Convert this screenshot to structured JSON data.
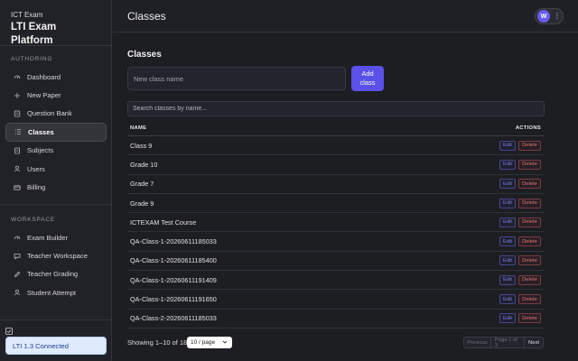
{
  "brand": {
    "subtitle": "ICT Exam",
    "title": "LTI Exam Platform"
  },
  "sidebar": {
    "authoring_label": "AUTHORING",
    "authoring_items": [
      {
        "label": "Dashboard",
        "icon": "gauge-icon"
      },
      {
        "label": "New Paper",
        "icon": "plus-icon"
      },
      {
        "label": "Question Bank",
        "icon": "book-icon"
      },
      {
        "label": "Classes",
        "icon": "list-icon",
        "active": true
      },
      {
        "label": "Subjects",
        "icon": "document-icon"
      },
      {
        "label": "Users",
        "icon": "user-icon"
      },
      {
        "label": "Billing",
        "icon": "card-icon"
      }
    ],
    "workspace_label": "WORKSPACE",
    "workspace_items": [
      {
        "label": "Exam Builder",
        "icon": "gauge-icon"
      },
      {
        "label": "Teacher Workspace",
        "icon": "chat-icon"
      },
      {
        "label": "Teacher Grading",
        "icon": "pencil-icon"
      },
      {
        "label": "Student Attempt",
        "icon": "user-icon"
      }
    ],
    "lti_badge": "LTI 1.3 Connected"
  },
  "topbar": {
    "title": "Classes",
    "avatar_initial": "W"
  },
  "main": {
    "heading": "Classes",
    "new_class_placeholder": "New class name",
    "add_button_label": "Add class",
    "search_placeholder": "Search classes by name...",
    "table": {
      "col_name": "NAME",
      "col_actions": "ACTIONS",
      "edit_label": "Edit",
      "delete_label": "Delete",
      "rows": [
        "Class 9",
        "Grade 10",
        "Grade 7",
        "Grade 9",
        "ICTEXAM Test Course",
        "QA-Class-1-20260611185033",
        "QA-Class-1-20260611185400",
        "QA-Class-1-20260611191409",
        "QA-Class-1-20260611191650",
        "QA-Class-2-20260611185033"
      ]
    },
    "footer": {
      "showing": "Showing 1–10 of 18",
      "page_size": "10 / page",
      "prev": "Previous",
      "page_info": "Page 1 of 2",
      "next": "Next"
    }
  },
  "colors": {
    "accent": "#5b50e8",
    "delete": "#e07474",
    "edit": "#7c7de0",
    "lti_badge_bg": "#dfeafd"
  }
}
